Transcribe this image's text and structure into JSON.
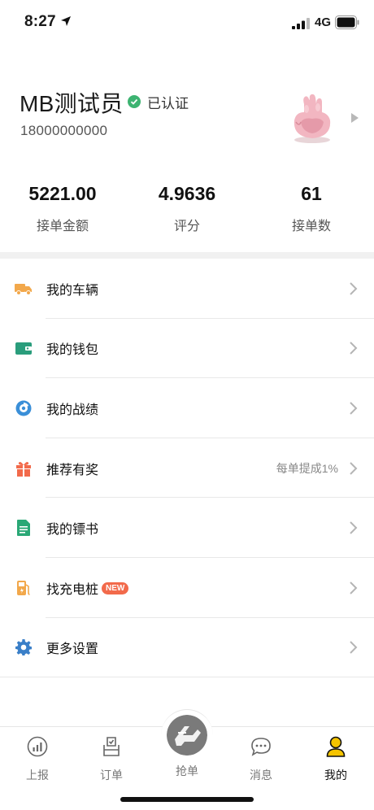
{
  "status_bar": {
    "time": "8:27",
    "network": "4G"
  },
  "profile": {
    "name": "MB测试员",
    "verified_label": "已认证",
    "phone": "18000000000"
  },
  "stats": [
    {
      "value": "5221.00",
      "label": "接单金额"
    },
    {
      "value": "4.9636",
      "label": "评分"
    },
    {
      "value": "61",
      "label": "接单数"
    }
  ],
  "menu": [
    {
      "label": "我的车辆",
      "icon": "truck-icon",
      "color": "#f2a84b"
    },
    {
      "label": "我的钱包",
      "icon": "wallet-icon",
      "color": "#2a9d7c"
    },
    {
      "label": "我的战绩",
      "icon": "achievement-icon",
      "color": "#3a8fd8"
    },
    {
      "label": "推荐有奖",
      "icon": "gift-icon",
      "color": "#f26a4b",
      "extra": "每单提成1%"
    },
    {
      "label": "我的镖书",
      "icon": "document-icon",
      "color": "#2aa876"
    },
    {
      "label": "找充电桩",
      "icon": "charging-station-icon",
      "color": "#f2a84b",
      "badge": "NEW"
    },
    {
      "label": "更多设置",
      "icon": "gear-icon",
      "color": "#3a7fc8"
    }
  ],
  "tabbar": [
    {
      "label": "上报",
      "icon": "chart-icon"
    },
    {
      "label": "订单",
      "icon": "order-icon"
    },
    {
      "label": "抢单",
      "icon": "grab-order-icon"
    },
    {
      "label": "消息",
      "icon": "message-icon"
    },
    {
      "label": "我的",
      "icon": "profile-icon",
      "active": true
    }
  ]
}
